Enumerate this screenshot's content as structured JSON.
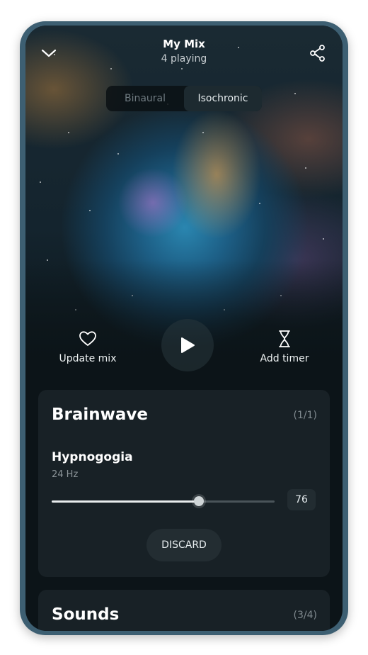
{
  "header": {
    "title": "My Mix",
    "subtitle": "4 playing",
    "collapse_icon": "chevron-down-icon",
    "share_icon": "share-icon"
  },
  "mode_toggle": {
    "options": [
      "Binaural",
      "Isochronic"
    ],
    "selected": "Isochronic"
  },
  "actions": {
    "update_mix_label": "Update mix",
    "update_mix_icon": "heart-icon",
    "play_icon": "play-icon",
    "add_timer_label": "Add timer",
    "add_timer_icon": "hourglass-icon"
  },
  "brainwave": {
    "title": "Brainwave",
    "count": "(1/1)",
    "track": {
      "name": "Hypnogogia",
      "frequency": "24 Hz",
      "volume": 76
    },
    "discard_label": "DISCARD"
  },
  "sounds": {
    "title": "Sounds",
    "count": "(3/4)"
  },
  "colors": {
    "background": "#0c1418",
    "card": "#182126",
    "accent_text": "#ffffff",
    "muted_text": "#8b9498"
  }
}
